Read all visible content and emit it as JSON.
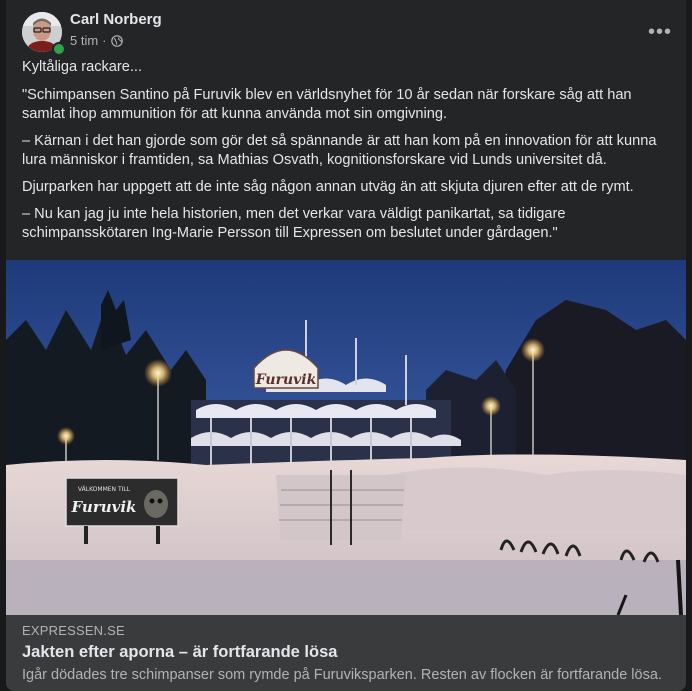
{
  "post": {
    "author": "Carl Norberg",
    "time": "5 tim",
    "separator": "·",
    "privacy_icon": "globe-icon",
    "more_icon": "more-options-icon",
    "more_label": "•••",
    "paragraphs": [
      "Kyltåliga rackare...",
      "\"Schimpansen Santino på Furuvik blev en världsnyhet för 10 år sedan när forskare såg att han samlat ihop ammunition för att kunna använda mot sin omgivning.",
      "– Kärnan i det han gjorde som gör det så spännande är att han kom på en innovation för att kunna lura människor i framtiden, sa Mathias Osvath, kognitionsforskare vid Lunds universitet då.",
      "Djurparken har uppgett att de inte såg någon annan utväg än att skjuta djuren efter att de rymt.",
      "– Nu kan jag ju inte hela historien, men det verkar vara väldigt panikartat, sa tidigare schimpansskötaren Ing-Marie Persson till Expressen om beslutet under gårdagen.\""
    ]
  },
  "link": {
    "domain": "EXPRESSEN.SE",
    "title": "Jakten efter aporna – är fortfarande lösa",
    "description": "Igår dödades tre schimpanser som rymde på Furuviksparken. Resten av flocken är fortfarande lösa.",
    "image": {
      "sign_text": "Furuvik",
      "welcome_line": "VÄLKOMMEN TILL",
      "welcome_name": "Furuvik"
    }
  },
  "colors": {
    "background": "#18191a",
    "card": "#242526",
    "footer": "#3a3b3c",
    "primary_text": "#e4e6eb",
    "secondary_text": "#b0b3b8",
    "online": "#31a24c"
  }
}
